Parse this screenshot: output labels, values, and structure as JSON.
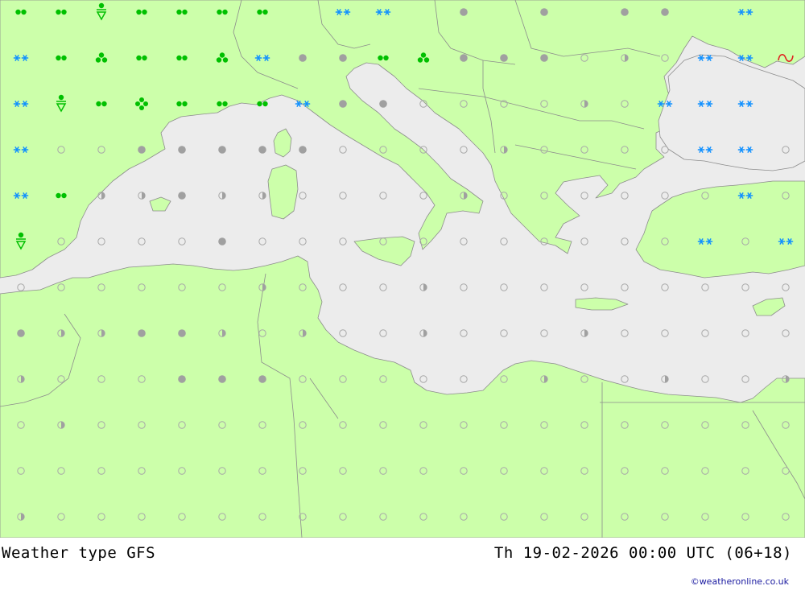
{
  "caption": {
    "title": "Weather type  GFS",
    "datetime": "Th 19-02-2026 00:00 UTC (06+18)"
  },
  "credit": "©weatheronline.co.uk",
  "colors": {
    "land": "#ccffaa",
    "sea": "#ececec",
    "border": "#8c8c8c",
    "rain": "#00c000",
    "snow": "#1090ff",
    "cloud_fill": "#a0a0a0",
    "cloud_outline": "#a8a8a8",
    "fog": "#e02020"
  },
  "legend_symbols": {
    "o": "clear",
    "h": "partly-cloudy",
    "c": "overcast",
    "d": "drizzle",
    "r": "rain",
    "R": "heavy-rain",
    "s": "showers",
    "S": "snow",
    "x": "snow-showers",
    "f": "fog"
  },
  "map": {
    "grid_cols": 20,
    "grid_rows": 12,
    "rows": [
      "ddsdddd xx c c cc x xx d",
      "xdrddrxccdrcccohoxxf",
      "xsdRdddxccoooohoxxx",
      "xoocccccoooohooooxxoo",
      "xdhhchhoooohooooooxoc",
      "soooocoooooooooooxoxx",
      "oooooohooohoooooooooh",
      "chhcchohoohooohooooooos",
      "hooocccoooooohoohoohoo",
      "ohoooooooooooooooooo",
      "oooooooooooooooooooo",
      "hooooooooooooooooooo"
    ]
  }
}
